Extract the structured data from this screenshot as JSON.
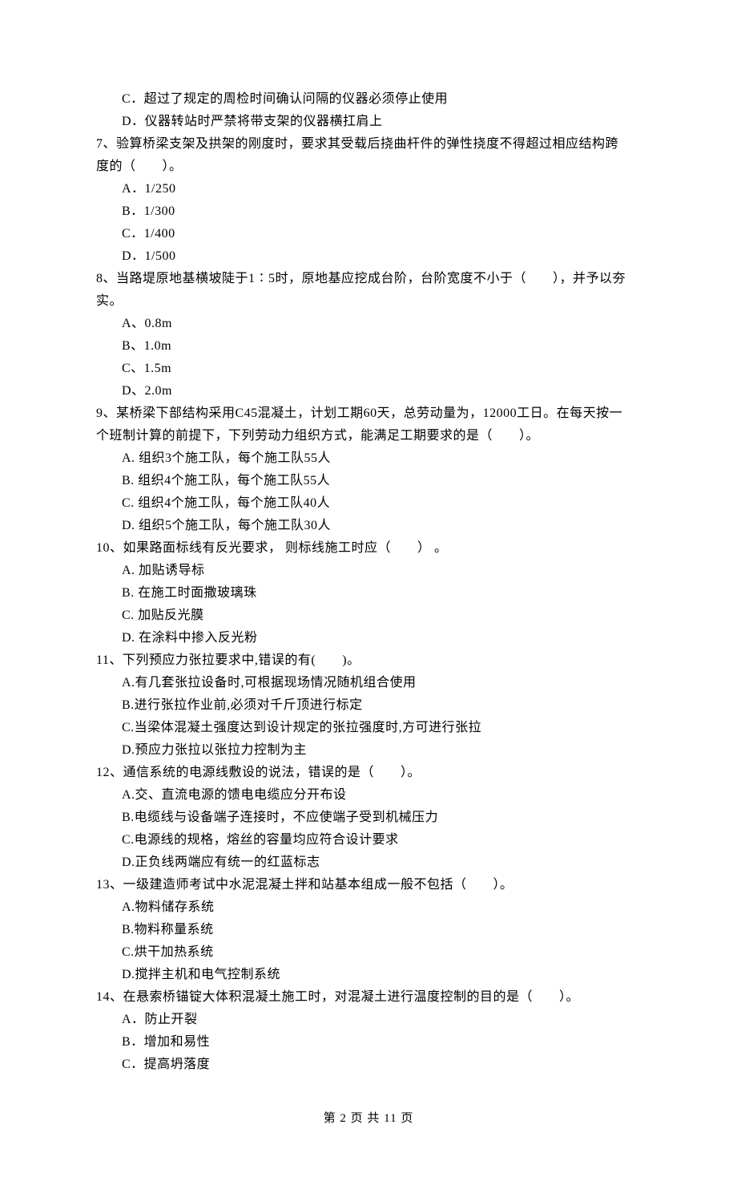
{
  "prevC": "C．超过了规定的周检时间确认问隔的仪器必须停止使用",
  "prevD": "D．仪器转站时严禁将带支架的仪器横扛肩上",
  "q7": {
    "stem1": "7、验算桥梁支架及拱架的刚度时，要求其受载后挠曲杆件的弹性挠度不得超过相应结构跨",
    "stem2": "度的（　　）。",
    "A": "A．1/250",
    "B": "B．1/300",
    "C": "C．1/400",
    "D": "D．1/500"
  },
  "q8": {
    "stem1": "8、当路堤原地基横坡陡于1∶5时，原地基应挖成台阶，台阶宽度不小于（　　），并予以夯",
    "stem2": "实。",
    "A": "A、0.8m",
    "B": "B、1.0m",
    "C": "C、1.5m",
    "D": "D、2.0m"
  },
  "q9": {
    "stem1": "9、某桥梁下部结构采用C45混凝土，计划工期60天，总劳动量为，12000工日。在每天按一",
    "stem2": "个班制计算的前提下，下列劳动力组织方式，能满足工期要求的是（　　）。",
    "A": "A. 组织3个施工队，每个施工队55人",
    "B": "B. 组织4个施工队，每个施工队55人",
    "C": "C. 组织4个施工队，每个施工队40人",
    "D": "D. 组织5个施工队，每个施工队30人"
  },
  "q10": {
    "stem": "10、如果路面标线有反光要求， 则标线施工时应（　　） 。",
    "A": "A. 加贴诱导标",
    "B": "B. 在施工时面撒玻璃珠",
    "C": "C. 加贴反光膜",
    "D": "D. 在涂料中掺入反光粉"
  },
  "q11": {
    "stem": "11、下列预应力张拉要求中,错误的有(　　)。",
    "A": "A.有几套张拉设备时,可根据现场情况随机组合使用",
    "B": "B.进行张拉作业前,必须对千斤顶进行标定",
    "C": "C.当梁体混凝土强度达到设计规定的张拉强度时,方可进行张拉",
    "D": "D.预应力张拉以张拉力控制为主"
  },
  "q12": {
    "stem": "12、通信系统的电源线敷设的说法，错误的是（　　）。",
    "A": "A.交、直流电源的馈电电缆应分开布设",
    "B": "B.电缆线与设备端子连接时，不应使端子受到机械压力",
    "C": "C.电源线的规格，熔丝的容量均应符合设计要求",
    "D": "D.正负线两端应有统一的红蓝标志"
  },
  "q13": {
    "stem": "13、一级建造师考试中水泥混凝土拌和站基本组成一般不包括（　　）。",
    "A": "A.物料储存系统",
    "B": "B.物料称量系统",
    "C": "C.烘干加热系统",
    "D": "D.搅拌主机和电气控制系统"
  },
  "q14": {
    "stem": "14、在悬索桥锚锭大体积混凝土施工时，对混凝土进行温度控制的目的是（　　）。",
    "A": "A．防止开裂",
    "B": "B．增加和易性",
    "C": "C．提高坍落度"
  },
  "footer": "第 2 页 共 11 页"
}
